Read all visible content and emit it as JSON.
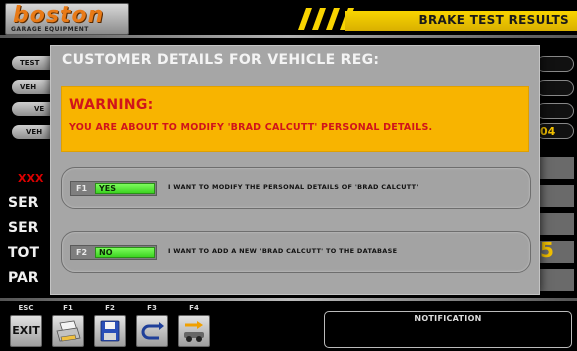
{
  "header": {
    "logo": "boston",
    "logo_subtitle": "GARAGE EQUIPMENT",
    "title": "BRAKE TEST RESULTS"
  },
  "background_form": {
    "rows": [
      "TEST",
      "VEH",
      "VE",
      "VEH"
    ],
    "xxx": "XXX",
    "labels": [
      "SER",
      "SER",
      "TOT",
      "PAR"
    ],
    "right_value": "04",
    "right_big": "5"
  },
  "dialog": {
    "title": "CUSTOMER DETAILS FOR VEHICLE REG:",
    "warning_title": "WARNING:",
    "warning_text": "YOU ARE ABOUT TO MODIFY 'BRAD CALCUTT' PERSONAL DETAILS.",
    "options": [
      {
        "key": "F1",
        "button": "YES",
        "text": "I WANT TO MODIFY THE PERSONAL DETAILS OF 'BRAD CALCUTT'"
      },
      {
        "key": "F2",
        "button": "NO",
        "text": "I WANT TO ADD A NEW 'BRAD CALCUTT' TO THE DATABASE"
      }
    ]
  },
  "footer": {
    "keys": [
      {
        "label": "ESC",
        "text": "EXIT",
        "icon": "exit-icon"
      },
      {
        "label": "F1",
        "text": "",
        "icon": "printer-icon"
      },
      {
        "label": "F2",
        "text": "",
        "icon": "save-disk-icon"
      },
      {
        "label": "F3",
        "text": "",
        "icon": "back-arrow-icon"
      },
      {
        "label": "F4",
        "text": "",
        "icon": "vehicle-arrow-icon"
      }
    ],
    "notification_label": "NOTIFICATION"
  },
  "colors": {
    "accent_yellow": "#f8d400",
    "warning_orange": "#f8b400",
    "warning_red": "#d0141b",
    "button_green": "#56e63a",
    "dialog_grey": "#a6a6a6"
  }
}
